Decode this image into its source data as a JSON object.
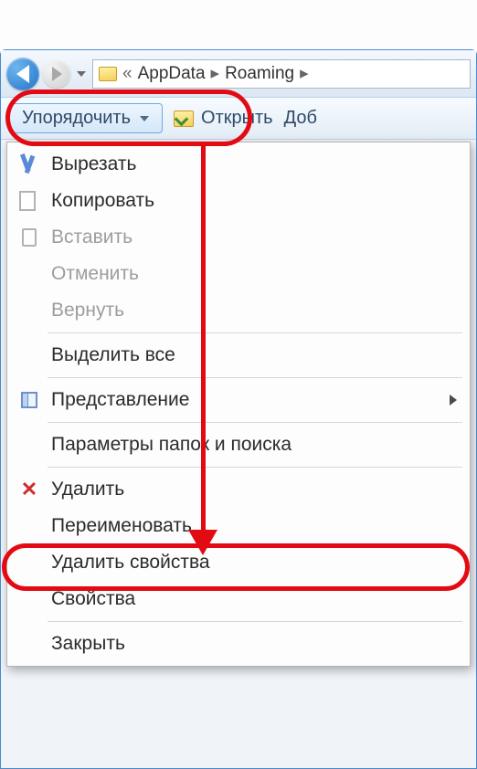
{
  "path": {
    "segments": [
      "AppData",
      "Roaming"
    ]
  },
  "toolbar": {
    "organize_label": "Упорядочить",
    "open_label": "Открыть",
    "add_label": "Доб"
  },
  "menu": {
    "cut": "Вырезать",
    "copy": "Копировать",
    "paste": "Вставить",
    "undo": "Отменить",
    "redo": "Вернуть",
    "select_all": "Выделить все",
    "layout": "Представление",
    "folder_options": "Параметры папок и поиска",
    "delete": "Удалить",
    "rename": "Переименовать",
    "remove_props": "Удалить свойства",
    "properties": "Свойства",
    "close": "Закрыть"
  }
}
